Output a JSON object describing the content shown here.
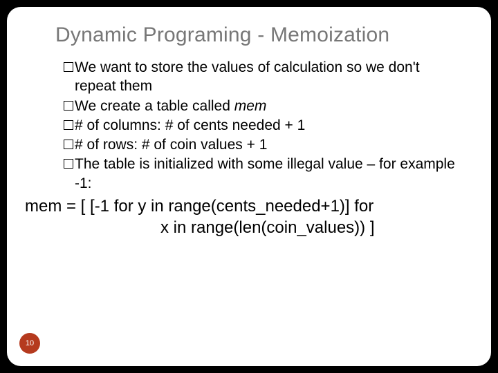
{
  "title": "Dynamic Programing - Memoization",
  "bullets": [
    {
      "pre": "We want to store the values of calculation so we don't repeat them",
      "em": "",
      "post": ""
    },
    {
      "pre": "We create a table called ",
      "em": "mem",
      "post": ""
    },
    {
      "pre": "# of columns: # of cents needed + 1",
      "em": "",
      "post": ""
    },
    {
      "pre": "# of rows: # of coin values + 1",
      "em": "",
      "post": ""
    },
    {
      "pre": "The table is initialized with some illegal value – for example -1:",
      "em": "",
      "post": ""
    }
  ],
  "code": {
    "line1": "mem = [  [-1 for y in range(cents_needed+1)] for",
    "line2": "x in range(len(coin_values)) ]"
  },
  "page_number": "10"
}
